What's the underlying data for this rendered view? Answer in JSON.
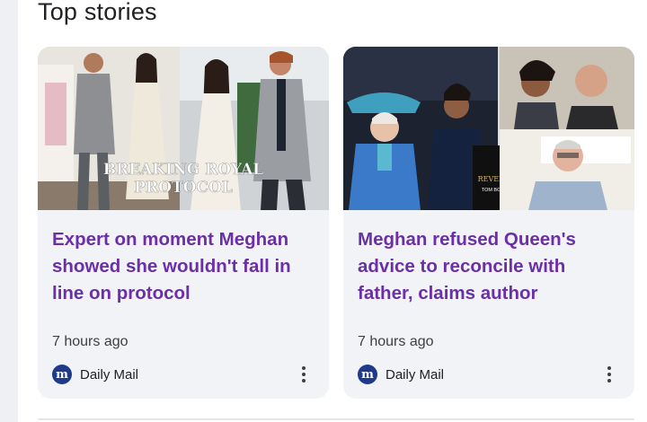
{
  "section": {
    "title": "Top stories"
  },
  "stories": [
    {
      "overlay_text": [
        "BREAKING ROYAL",
        "PROTOCOL"
      ],
      "headline": "Expert on moment Meghan showed she wouldn't fall in line on protocol",
      "time": "7 hours ago",
      "source": "Daily Mail",
      "source_logo": "m"
    },
    {
      "book_title": "REVENGE",
      "book_author": "TOM BOWER",
      "headline": "Meghan refused Queen's advice to reconcile with father, claims author",
      "time": "7 hours ago",
      "source": "Daily Mail",
      "source_logo": "m"
    }
  ],
  "colors": {
    "headline": "#6b2fa8",
    "card_bg": "#f1f3f6",
    "logo_bg": "#1f3a8a"
  }
}
